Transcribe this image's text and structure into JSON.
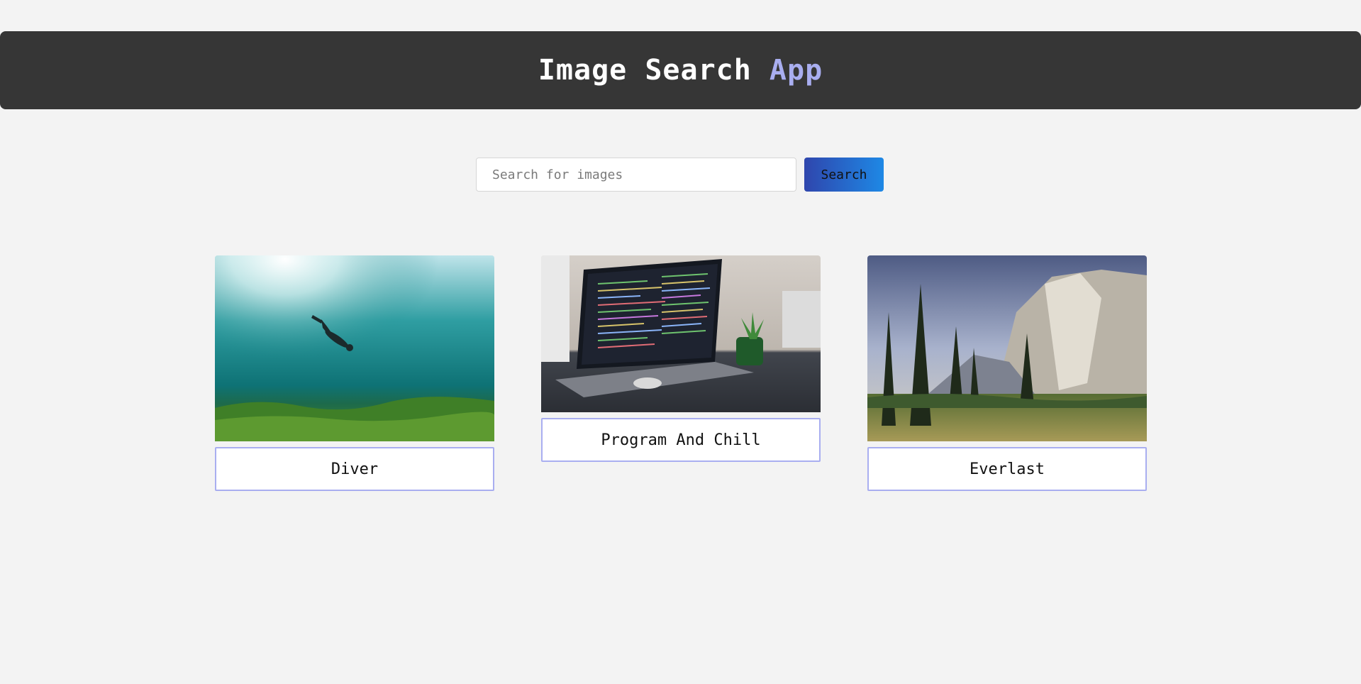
{
  "header": {
    "title_main": "Image Search",
    "title_accent": "App"
  },
  "search": {
    "placeholder": "Search for images",
    "value": "",
    "button_label": "Search"
  },
  "results": [
    {
      "caption": "Diver",
      "image_icon": "underwater-diver-photo"
    },
    {
      "caption": "Program And Chill",
      "image_icon": "laptop-code-photo"
    },
    {
      "caption": "Everlast",
      "image_icon": "mountain-forest-photo"
    }
  ],
  "colors": {
    "header_bg": "#363636",
    "accent": "#a9aef0",
    "button_gradient_start": "#2f46ad",
    "button_gradient_end": "#1e88e5"
  }
}
